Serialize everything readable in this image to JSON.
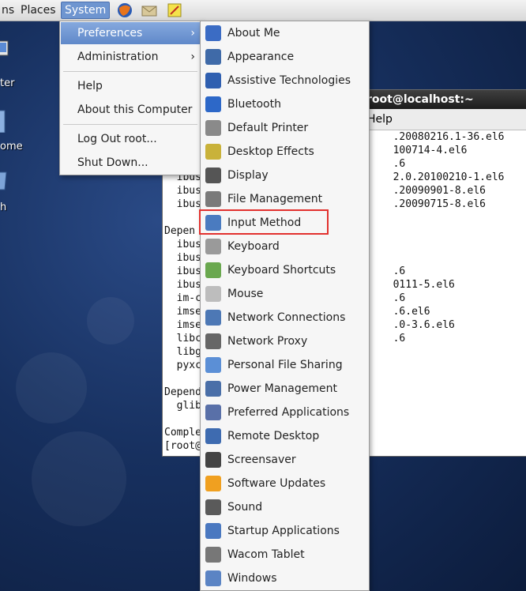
{
  "panel": {
    "menus": [
      "ns",
      "Places",
      "System"
    ],
    "launchers": [
      "firefox-icon",
      "mail-icon",
      "notes-icon"
    ]
  },
  "desktop": {
    "icon_labels": [
      "ter",
      "ome",
      "h"
    ]
  },
  "terminal": {
    "title": "root@localhost:~",
    "menu_help": "Help",
    "lines": [
      "                                     .20080216.1-36.el6",
      "                                     100714-4.el6",
      "                                     .6",
      "  ibus                               2.0.20100210-1.el6",
      "  ibus                               .20090901-8.el6",
      "  ibus                               .20090715-8.el6",
      "",
      "Depen",
      "  ibus",
      "  ibus",
      "  ibus                               .6",
      "  ibus                               0111-5.el6",
      "  im-c                               .6",
      "  imse                               .6.el6",
      "  imse                               .0-3.6.el6",
      "  libc                               .6",
      "  libg",
      "  pyxc",
      "",
      "Depend",
      "  glib",
      "",
      "Comple",
      "[root@"
    ]
  },
  "system_menu": {
    "items": [
      {
        "label": "Preferences",
        "submenu": true,
        "active": true
      },
      {
        "label": "Administration",
        "submenu": true
      },
      {
        "label": "Help"
      },
      {
        "label": "About this Computer"
      },
      {
        "label": "Log Out root..."
      },
      {
        "label": "Shut Down..."
      }
    ]
  },
  "preferences_menu": {
    "items": [
      {
        "label": "About Me",
        "icon": "about-me-icon",
        "color": "#3b6cc4"
      },
      {
        "label": "Appearance",
        "icon": "appearance-icon",
        "color": "#3f6aa8"
      },
      {
        "label": "Assistive Technologies",
        "icon": "accessibility-icon",
        "color": "#2f5fb0"
      },
      {
        "label": "Bluetooth",
        "icon": "bluetooth-icon",
        "color": "#2d68c8"
      },
      {
        "label": "Default Printer",
        "icon": "printer-icon",
        "color": "#8a8a8a"
      },
      {
        "label": "Desktop Effects",
        "icon": "desktop-effects-icon",
        "color": "#c9b23a"
      },
      {
        "label": "Display",
        "icon": "display-icon",
        "color": "#555555"
      },
      {
        "label": "File Management",
        "icon": "file-management-icon",
        "color": "#7a7a7a"
      },
      {
        "label": "Input Method",
        "icon": "input-method-icon",
        "color": "#4a7bc0"
      },
      {
        "label": "Keyboard",
        "icon": "keyboard-icon",
        "color": "#9a9a9a"
      },
      {
        "label": "Keyboard Shortcuts",
        "icon": "keyboard-shortcuts-icon",
        "color": "#6aa84f"
      },
      {
        "label": "Mouse",
        "icon": "mouse-icon",
        "color": "#bdbdbd"
      },
      {
        "label": "Network Connections",
        "icon": "network-connections-icon",
        "color": "#4d78b5"
      },
      {
        "label": "Network Proxy",
        "icon": "network-proxy-icon",
        "color": "#666666"
      },
      {
        "label": "Personal File Sharing",
        "icon": "file-sharing-icon",
        "color": "#5b8fd6"
      },
      {
        "label": "Power Management",
        "icon": "power-management-icon",
        "color": "#4a6fa8"
      },
      {
        "label": "Preferred Applications",
        "icon": "preferred-applications-icon",
        "color": "#5970a8"
      },
      {
        "label": "Remote Desktop",
        "icon": "remote-desktop-icon",
        "color": "#3e6bb0"
      },
      {
        "label": "Screensaver",
        "icon": "screensaver-icon",
        "color": "#444444"
      },
      {
        "label": "Software Updates",
        "icon": "software-updates-icon",
        "color": "#f0a020"
      },
      {
        "label": "Sound",
        "icon": "sound-icon",
        "color": "#5a5a5a"
      },
      {
        "label": "Startup Applications",
        "icon": "startup-applications-icon",
        "color": "#4a78c0"
      },
      {
        "label": "Wacom Tablet",
        "icon": "wacom-tablet-icon",
        "color": "#777777"
      },
      {
        "label": "Windows",
        "icon": "windows-icon",
        "color": "#5b84c4"
      }
    ],
    "highlighted": "Input Method",
    "highlight_color": "#e2312e"
  }
}
